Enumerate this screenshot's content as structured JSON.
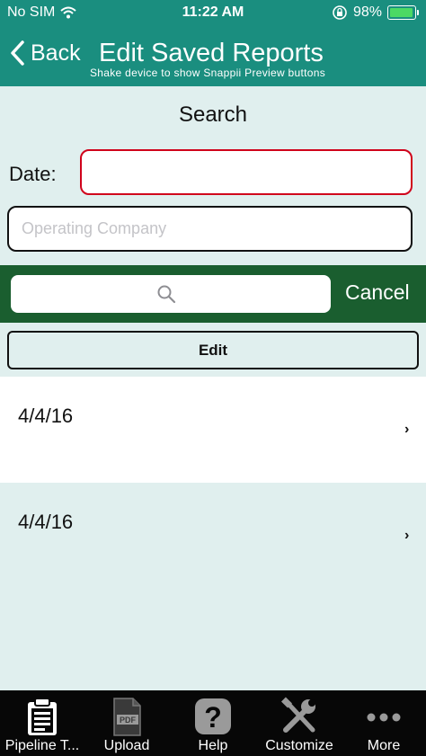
{
  "status_bar": {
    "carrier": "No SIM",
    "time": "11:22 AM",
    "battery_percent": "98%",
    "battery_level": 0.98
  },
  "nav": {
    "back_label": "Back",
    "title": "Edit Saved Reports",
    "subtitle": "Shake device to show Snappii Preview buttons"
  },
  "search_form": {
    "heading": "Search",
    "date_label": "Date:",
    "date_value": "",
    "company_value": "",
    "company_placeholder": "Operating Company"
  },
  "search_bar": {
    "query": "",
    "cancel_label": "Cancel"
  },
  "edit_label": "Edit",
  "reports": [
    {
      "date": "4/4/16"
    },
    {
      "date": "4/4/16"
    }
  ],
  "tab_bar": {
    "items": [
      {
        "label": "Pipeline T...",
        "icon": "clipboard-icon"
      },
      {
        "label": "Upload",
        "icon": "pdf-icon"
      },
      {
        "label": "Help",
        "icon": "help-icon"
      },
      {
        "label": "Customize",
        "icon": "tools-icon"
      },
      {
        "label": "More",
        "icon": "more-icon"
      }
    ]
  },
  "colors": {
    "header": "#1a8e7f",
    "search_bar": "#1a5e2f",
    "background": "#e0efee",
    "tab_bar": "#070707",
    "date_border": "#d0021b"
  }
}
